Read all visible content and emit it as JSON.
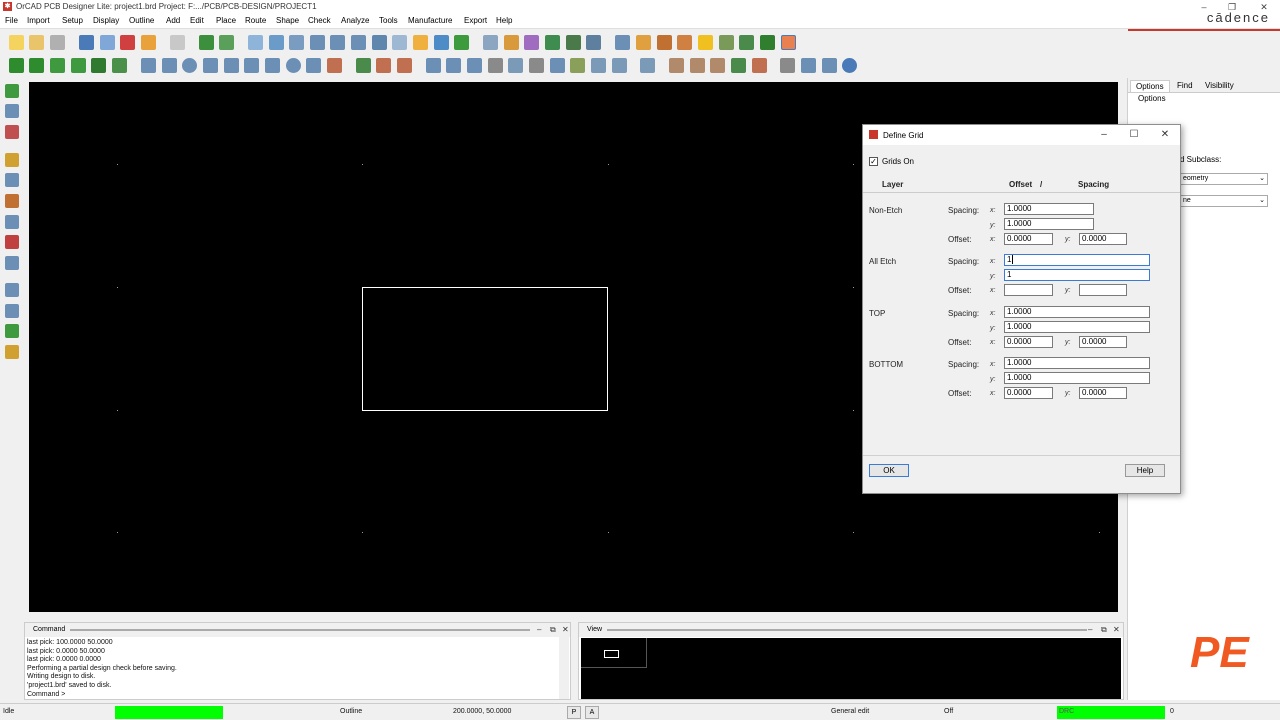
{
  "window": {
    "title": "OrCAD PCB Designer Lite: project1.brd  Project: F:.../PCB/PCB-DESIGN/PROJECT1",
    "brand": "cādence",
    "minimize": "–",
    "maximize": "❐",
    "close": "✕"
  },
  "menu": [
    "File",
    "Import",
    "Setup",
    "Display",
    "Outline",
    "Add",
    "Edit",
    "Place",
    "Route",
    "Shape",
    "Check",
    "Analyze",
    "Tools",
    "Manufacture",
    "Export",
    "Help"
  ],
  "right_panel": {
    "tabs": [
      "Options",
      "Find",
      "Visibility"
    ],
    "header": "Options",
    "subclass_label": "d Subclass:",
    "class_value": "eometry",
    "subclass_value": "ne"
  },
  "dialog": {
    "title": "Define Grid",
    "grids_on_label": "Grids On",
    "grids_on_checked": true,
    "col_layer": "Layer",
    "col_offset": "Offset",
    "col_slash": "/",
    "col_spacing": "Spacing",
    "spacing_label": "Spacing:",
    "offset_label": "Offset:",
    "x_label": "x:",
    "y_label": "y:",
    "layers": [
      {
        "name": "Non-Etch",
        "spacing_x": "1.0000",
        "spacing_y": "1.0000",
        "offset_x": "0.0000",
        "offset_y": "0.0000"
      },
      {
        "name": "All Etch",
        "spacing_x": "1",
        "spacing_y": "1",
        "offset_x": "",
        "offset_y": ""
      },
      {
        "name": "TOP",
        "spacing_x": "1.0000",
        "spacing_y": "1.0000",
        "offset_x": "0.0000",
        "offset_y": "0.0000"
      },
      {
        "name": "BOTTOM",
        "spacing_x": "1.0000",
        "spacing_y": "1.0000",
        "offset_x": "0.0000",
        "offset_y": "0.0000"
      }
    ],
    "ok_label": "OK",
    "help_label": "Help"
  },
  "command_panel": {
    "title": "Command",
    "lines": [
      "last pick:  100.0000 50.0000",
      "last pick:   0.0000 50.0000",
      "last pick:   0.0000 0.0000",
      "Performing a partial design check before saving.",
      "Writing design to disk.",
      "'project1.brd' saved to disk.",
      "Command >"
    ]
  },
  "view_panel": {
    "title": "View"
  },
  "panel_buttons": {
    "minimize": "–",
    "float": "⧉",
    "close": "✕"
  },
  "statusbar": {
    "state": "Idle",
    "mode": "Outline",
    "coords": "200.0000, 50.0000",
    "p_button": "P",
    "a_button": "A",
    "edit_mode": "General edit",
    "off": "Off",
    "drc": "DRC",
    "drc_count": "0"
  },
  "watermark": "PE",
  "colors": {
    "canvas": "#000000",
    "status_green": "#00ff00",
    "brand_red": "#c8362c",
    "watermark": "#f05a22"
  }
}
